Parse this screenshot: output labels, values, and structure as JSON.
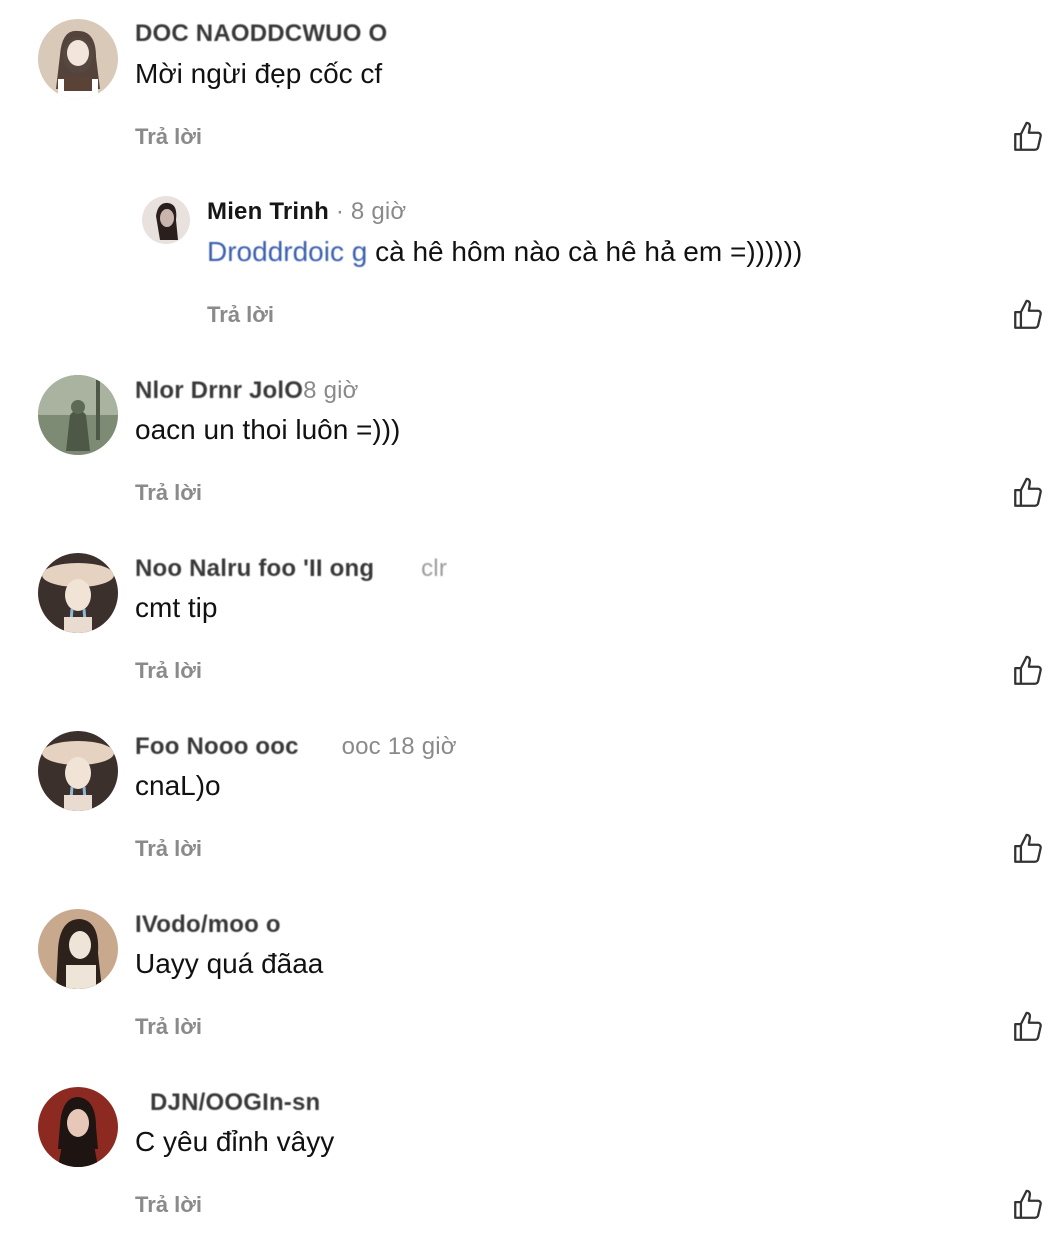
{
  "comments": [
    {
      "name": "DOC NAODDCWUO O",
      "time": "",
      "text": "Mời ngừi đẹp cốc cf",
      "reply_label": "Trả lời",
      "avatar_colors": [
        "#d9c9b8",
        "#3b2c24",
        "#f2e6dc"
      ]
    },
    {
      "name": "Mien Trinh",
      "time": "· 8 giờ",
      "mention": "Droddrdoic g",
      "text": " cà hê hôm nào cà hê hả em =))))))",
      "reply_label": "Trả lời",
      "avatar_colors": [
        "#e8e1de",
        "#2a1f1d",
        "#c9b5ad"
      ]
    },
    {
      "name": "Nlor Drnr JolO",
      "time": "8 giờ",
      "text": "oacn un thoi luôn =)))",
      "reply_label": "Trả lời",
      "avatar_colors": [
        "#7d8a74",
        "#4d5946",
        "#a9b3a0"
      ]
    },
    {
      "name": "Noo Nalru foo 'II ong",
      "time": "clr",
      "text": "cmt tip",
      "reply_label": "Trả lời",
      "avatar_colors": [
        "#e6d2c0",
        "#2b2420",
        "#8fb9d6"
      ]
    },
    {
      "name": "Foo Nooo ooc",
      "time": "ooc 18 giờ",
      "text": "cnaL)o",
      "reply_label": "Trả lời",
      "avatar_colors": [
        "#e6d2c0",
        "#2b2420",
        "#8fb9d6"
      ]
    },
    {
      "name": "IVodo/moo o",
      "time": "",
      "text": "Uayy quá đãaa",
      "reply_label": "Trả lời",
      "avatar_colors": [
        "#c9a98e",
        "#2d211b",
        "#efe4d8"
      ]
    },
    {
      "name": "DJN/OOGIn-sn",
      "time": "",
      "text": "C yêu đỉnh vâyy",
      "reply_label": "Trả lời",
      "avatar_colors": [
        "#8c2a22",
        "#1e1412",
        "#e7c8b8"
      ]
    }
  ],
  "icons": {
    "like": "thumbs-up-outline-icon"
  }
}
